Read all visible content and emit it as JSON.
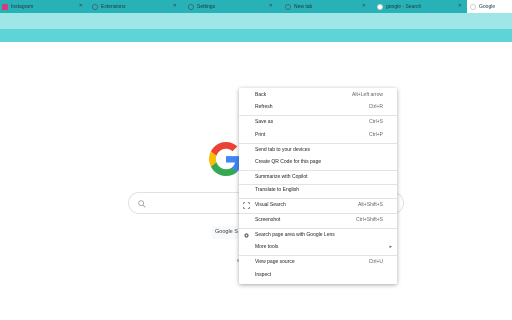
{
  "tabs": [
    {
      "title": "Instagram",
      "favicon": "instagram-icon"
    },
    {
      "title": "Extensions",
      "favicon": "globe-icon"
    },
    {
      "title": "Settings",
      "favicon": "settings-icon"
    },
    {
      "title": "New tab",
      "favicon": "globe-icon"
    },
    {
      "title": "google - Search",
      "favicon": "google-icon"
    },
    {
      "title": "Google",
      "favicon": "google-icon",
      "active": true
    }
  ],
  "colors": {
    "tabstrip": "#29b1b8",
    "toolbar": "#9fe6e6",
    "bookmarks_bar": "#5ed4d8",
    "google_blue": "#4285f4",
    "google_red": "#ea4335",
    "google_yellow": "#fbbc05",
    "google_green": "#34a853"
  },
  "page": {
    "search_button_label": "Google S",
    "link_fragment": "e"
  },
  "context_menu": {
    "back": {
      "label": "Back",
      "shortcut": "Alt+Left arrow"
    },
    "refresh": {
      "label": "Refresh",
      "shortcut": "Ctrl+R"
    },
    "save_as": {
      "label": "Save as",
      "shortcut": "Ctrl+S"
    },
    "print": {
      "label": "Print",
      "shortcut": "Ctrl+P"
    },
    "send_tab": {
      "label": "Send tab to your devices"
    },
    "qr_code": {
      "label": "Create QR Code for this page"
    },
    "copilot": {
      "label": "Summarize with Copilot"
    },
    "translate": {
      "label": "Translate to English"
    },
    "visual_search": {
      "label": "Visual Search",
      "shortcut": "Alt+Shift+S"
    },
    "screenshot": {
      "label": "Screenshot",
      "shortcut": "Ctrl+Shift+S"
    },
    "lens": {
      "label": "Search page area with Google Lens"
    },
    "more_tools": {
      "label": "More tools"
    },
    "view_source": {
      "label": "View page source",
      "shortcut": "Ctrl+U"
    },
    "inspect": {
      "label": "Inspect"
    }
  }
}
